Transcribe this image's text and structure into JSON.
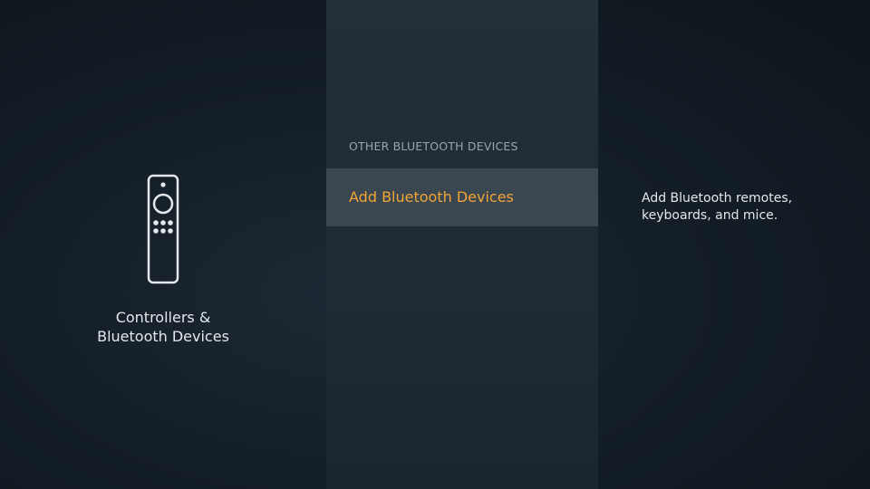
{
  "left_panel": {
    "icon": "remote-control-icon",
    "title": "Controllers &\nBluetooth Devices"
  },
  "middle_panel": {
    "section_header": "OTHER BLUETOOTH DEVICES",
    "items": [
      {
        "label": "Add Bluetooth Devices",
        "selected": true
      }
    ]
  },
  "right_panel": {
    "description": "Add Bluetooth remotes, keyboards, and mice."
  },
  "colors": {
    "accent": "#f0a536",
    "selected_background": "#3a4650",
    "text": "#e4e8ec",
    "header_text": "#9aa4ad"
  }
}
